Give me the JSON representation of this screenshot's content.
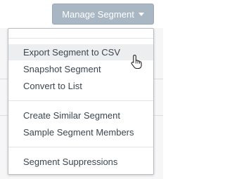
{
  "toolbar": {
    "manage_label": "Manage Segment",
    "manage_icon": "caret-down-icon"
  },
  "menu": {
    "items": [
      {
        "label": "Export Segment to CSV"
      },
      {
        "label": "Snapshot Segment"
      },
      {
        "label": "Convert to List"
      },
      {
        "label": "Create Similar Segment"
      },
      {
        "label": "Sample Segment Members"
      },
      {
        "label": "Segment Suppressions"
      }
    ]
  },
  "colors": {
    "button_bg": "#a9b7c4",
    "menu_text": "#3b4650",
    "hover_bg": "#eceef0"
  },
  "cursor_icon": "hand-pointer-icon"
}
